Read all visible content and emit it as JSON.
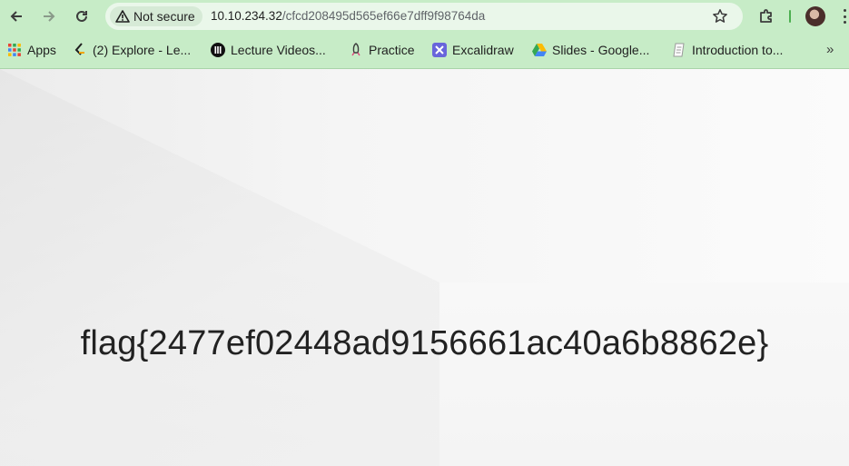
{
  "browser": {
    "security_label": "Not secure",
    "url_host": "10.10.234.32",
    "url_path": "/cfcd208495d565ef66e7dff9f98764da",
    "accent_color": "#c7ecc7"
  },
  "bookmarks": {
    "items": [
      {
        "label": "Apps",
        "icon": "apps-grid-icon"
      },
      {
        "label": "(2) Explore - Le...",
        "icon": "leetcode-icon"
      },
      {
        "label": "Lecture Videos...",
        "icon": "lecture-icon"
      },
      {
        "label": "Practice",
        "icon": "rocket-icon"
      },
      {
        "label": "Excalidraw",
        "icon": "excalidraw-icon"
      },
      {
        "label": "Slides - Google...",
        "icon": "google-drive-icon"
      },
      {
        "label": "Introduction to...",
        "icon": "page-icon"
      }
    ],
    "overflow_icon": "chevron-double-right-icon"
  },
  "page": {
    "flag_text": "flag{2477ef02448ad9156661ac40a6b8862e}"
  }
}
